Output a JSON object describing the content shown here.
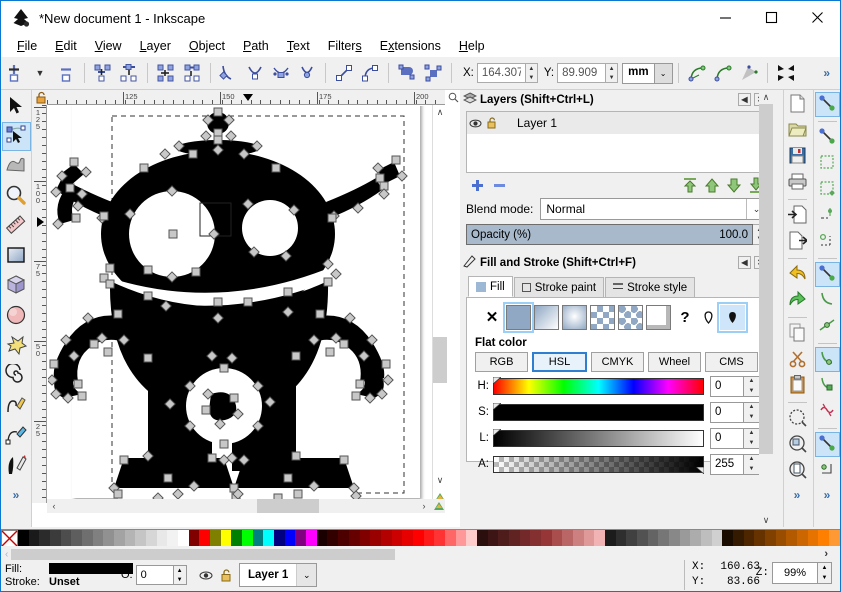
{
  "window": {
    "title": "*New document 1 - Inkscape",
    "app_icon": "inkscape-logo-icon",
    "controls": [
      {
        "name": "minimize-button",
        "glyph": "minimize-icon"
      },
      {
        "name": "maximize-button",
        "glyph": "maximize-icon"
      },
      {
        "name": "close-button",
        "glyph": "close-icon"
      }
    ]
  },
  "menubar": {
    "items": [
      {
        "label": "File",
        "mnemonic": "F"
      },
      {
        "label": "Edit",
        "mnemonic": "E"
      },
      {
        "label": "View",
        "mnemonic": "V"
      },
      {
        "label": "Layer",
        "mnemonic": "L"
      },
      {
        "label": "Object",
        "mnemonic": "O"
      },
      {
        "label": "Path",
        "mnemonic": "P"
      },
      {
        "label": "Text",
        "mnemonic": "T"
      },
      {
        "label": "Filters",
        "mnemonic": "s"
      },
      {
        "label": "Extensions",
        "mnemonic": "x"
      },
      {
        "label": "Help",
        "mnemonic": "H"
      }
    ]
  },
  "toolcontrols": {
    "x_label": "X:",
    "x_value": "164.307",
    "y_label": "Y:",
    "y_value": "89.909",
    "unit": "mm",
    "overflow_label": "»",
    "buttons": [
      "insert-node-icon",
      "insert-node-dropdown-icon",
      "delete-node-icon",
      "break-path-icon",
      "join-nodes-icon",
      "join-segment-icon",
      "delete-segment-icon",
      "node-cusp-icon",
      "node-smooth-icon",
      "node-symmetric-icon",
      "node-auto-icon",
      "segment-line-icon",
      "segment-curve-icon",
      "object-to-path-icon",
      "stroke-to-path-icon",
      "show-transform-handles-icon",
      "show-path-outline-icon",
      "show-clip-paths-icon",
      "show-mask-paths-icon"
    ]
  },
  "toolbox": {
    "tools": [
      {
        "name": "selector-tool",
        "icon": "arrow-cursor-icon",
        "active": false
      },
      {
        "name": "node-tool",
        "icon": "node-editor-icon",
        "active": true
      },
      {
        "name": "tweak-tool",
        "icon": "tweak-icon",
        "active": false
      },
      {
        "name": "zoom-tool",
        "icon": "magnifier-icon",
        "active": false
      },
      {
        "name": "measure-tool",
        "icon": "ruler-icon",
        "active": false
      },
      {
        "name": "rectangle-tool",
        "icon": "rectangle-icon",
        "active": false
      },
      {
        "name": "box3d-tool",
        "icon": "cube-icon",
        "active": false
      },
      {
        "name": "ellipse-tool",
        "icon": "circle-icon",
        "active": false
      },
      {
        "name": "star-tool",
        "icon": "star-icon",
        "active": false
      },
      {
        "name": "spiral-tool",
        "icon": "spiral-icon",
        "active": false
      },
      {
        "name": "pencil-tool",
        "icon": "pencil-icon",
        "active": false
      },
      {
        "name": "pen-tool",
        "icon": "pen-bezier-icon",
        "active": false
      },
      {
        "name": "calligraphy-tool",
        "icon": "calligraphy-pen-icon",
        "active": false
      }
    ],
    "overflow_label": "»"
  },
  "canvas": {
    "ruler_h_ticks": [
      "125",
      "150",
      "175",
      "200"
    ],
    "ruler_v_ticks": [
      "125",
      "100",
      "75",
      "50",
      "25"
    ],
    "artwork_name": "robot-silhouette-path",
    "zoom_corner_icon": "zoom-icon"
  },
  "layers_panel": {
    "title": "Layers (Shift+Ctrl+L)",
    "title_icon": "layers-icon",
    "collapse_icon": "collapse-icon",
    "close_icon": "close-icon",
    "rows": [
      {
        "name": "Layer 1",
        "visible_icon": "eye-icon",
        "lock_icon": "unlock-icon"
      }
    ],
    "buttons": [
      {
        "name": "add-layer-button",
        "icon": "plus-icon"
      },
      {
        "name": "remove-layer-button",
        "icon": "minus-icon"
      },
      {
        "name": "raise-to-top-button",
        "icon": "raise-top-icon"
      },
      {
        "name": "raise-layer-button",
        "icon": "raise-icon"
      },
      {
        "name": "lower-layer-button",
        "icon": "lower-icon"
      },
      {
        "name": "lower-to-bottom-button",
        "icon": "lower-bottom-icon"
      }
    ],
    "blend_mode_label": "Blend mode:",
    "blend_mode_value": "Normal",
    "opacity_label": "Opacity (%)",
    "opacity_value": "100.0"
  },
  "fill_stroke_panel": {
    "title": "Fill and Stroke (Shift+Ctrl+F)",
    "title_icon": "fill-stroke-icon",
    "collapse_icon": "collapse-icon",
    "close_icon": "close-icon",
    "tabs": [
      {
        "label": "Fill",
        "icon": "fill-swatch-icon",
        "active": true
      },
      {
        "label": "Stroke paint",
        "icon": "stroke-paint-icon",
        "active": false
      },
      {
        "label": "Stroke style",
        "icon": "stroke-style-icon",
        "active": false
      }
    ],
    "paint_types": [
      {
        "name": "no-paint-button",
        "icon": "x-icon",
        "selected": false
      },
      {
        "name": "flat-color-button",
        "icon": "flat-color-icon",
        "selected": true
      },
      {
        "name": "linear-gradient-button",
        "icon": "linear-gradient-icon",
        "selected": false
      },
      {
        "name": "radial-gradient-button",
        "icon": "radial-gradient-icon",
        "selected": false
      },
      {
        "name": "pattern-button",
        "icon": "pattern-icon",
        "selected": false
      },
      {
        "name": "swatch-button",
        "icon": "swatch-icon",
        "selected": false
      },
      {
        "name": "unknown-paint-button",
        "icon": "unknown-paint-icon",
        "selected": false
      },
      {
        "name": "unknown-question-button",
        "icon": "question-mark-icon",
        "selected": false
      },
      {
        "name": "fill-rule-evenodd-button",
        "icon": "fill-rule-evenodd-icon",
        "selected": false
      },
      {
        "name": "fill-rule-nonzero-button",
        "icon": "fill-rule-nonzero-icon",
        "selected": true
      }
    ],
    "flat_color_label": "Flat color",
    "color_modes": [
      {
        "label": "RGB",
        "selected": false
      },
      {
        "label": "HSL",
        "selected": true
      },
      {
        "label": "CMYK",
        "selected": false
      },
      {
        "label": "Wheel",
        "selected": false
      },
      {
        "label": "CMS",
        "selected": false
      }
    ],
    "channels": [
      {
        "label": "H:",
        "value": "0",
        "slider": "hue-slider"
      },
      {
        "label": "S:",
        "value": "0",
        "slider": "saturation-slider"
      },
      {
        "label": "L:",
        "value": "0",
        "slider": "lightness-slider"
      },
      {
        "label": "A:",
        "value": "255",
        "slider": "alpha-slider"
      }
    ]
  },
  "command_bar": {
    "buttons": [
      {
        "name": "new-document-button",
        "icon": "new-document-icon"
      },
      {
        "name": "open-document-button",
        "icon": "open-folder-icon"
      },
      {
        "name": "save-document-button",
        "icon": "save-disk-icon"
      },
      {
        "name": "print-button",
        "icon": "printer-icon"
      },
      {
        "name": "import-button",
        "icon": "import-icon"
      },
      {
        "name": "export-button",
        "icon": "export-icon"
      },
      {
        "name": "undo-button",
        "icon": "undo-arrow-icon"
      },
      {
        "name": "redo-button",
        "icon": "redo-arrow-icon"
      },
      {
        "name": "copy-button",
        "icon": "copy-icon"
      },
      {
        "name": "cut-button",
        "icon": "scissors-icon"
      },
      {
        "name": "paste-button",
        "icon": "clipboard-icon"
      },
      {
        "name": "zoom-selection-button",
        "icon": "zoom-selection-icon"
      },
      {
        "name": "zoom-drawing-button",
        "icon": "zoom-drawing-icon"
      },
      {
        "name": "zoom-page-button",
        "icon": "zoom-page-icon"
      }
    ],
    "overflow_label": "»"
  },
  "snap_bar": {
    "buttons": [
      {
        "name": "enable-snapping-button",
        "icon": "snap-icon",
        "selected": true
      },
      {
        "name": "snap-bounding-box-button",
        "icon": "snap-bbox-icon",
        "selected": false
      },
      {
        "name": "snap-bbox-edge-button",
        "icon": "snap-bbox-edge-icon",
        "selected": false
      },
      {
        "name": "snap-bbox-corner-button",
        "icon": "snap-bbox-corner-icon",
        "selected": false
      },
      {
        "name": "snap-bbox-edge-midpoint-button",
        "icon": "snap-edge-midpoint-icon",
        "selected": false
      },
      {
        "name": "snap-bbox-center-button",
        "icon": "snap-center-icon",
        "selected": false
      },
      {
        "name": "snap-nodes-button",
        "icon": "snap-nodes-icon",
        "selected": true
      },
      {
        "name": "snap-paths-button",
        "icon": "snap-path-icon",
        "selected": false
      },
      {
        "name": "snap-path-intersection-button",
        "icon": "snap-intersection-icon",
        "selected": false
      },
      {
        "name": "snap-cusp-nodes-button",
        "icon": "snap-cusp-icon",
        "selected": true
      },
      {
        "name": "snap-smooth-nodes-button",
        "icon": "snap-smooth-icon",
        "selected": false
      },
      {
        "name": "snap-midpoints-button",
        "icon": "snap-midpoint-icon",
        "selected": false
      },
      {
        "name": "snap-others-button",
        "icon": "snap-others-icon",
        "selected": true
      },
      {
        "name": "snap-page-border-button",
        "icon": "snap-page-border-icon",
        "selected": false
      }
    ],
    "overflow_label": "»"
  },
  "palette": {
    "none_swatch": "no-color-icon",
    "colors": [
      "#000000",
      "#1a1a1a",
      "#2b2b2b",
      "#3b3b3b",
      "#4d4d4d",
      "#5e5e5e",
      "#6f6f6f",
      "#808080",
      "#919191",
      "#a3a3a3",
      "#b4b4b4",
      "#c5c5c5",
      "#d6d6d6",
      "#e8e8e8",
      "#f2f2f2",
      "#ffffff",
      "#800000",
      "#ff0000",
      "#808000",
      "#ffff00",
      "#008000",
      "#00ff00",
      "#008080",
      "#00ffff",
      "#000080",
      "#0000ff",
      "#800080",
      "#ff00ff",
      "#1a0000",
      "#330000",
      "#4d0000",
      "#660000",
      "#800000",
      "#990000",
      "#b30000",
      "#cc0000",
      "#e60000",
      "#ff0000",
      "#ff1a1a",
      "#ff3333",
      "#ff6666",
      "#ff9999",
      "#ffcccc",
      "#2b0f0f",
      "#3d1515",
      "#4f1c1c",
      "#612222",
      "#732929",
      "#853030",
      "#973636",
      "#a94d4d",
      "#bb6666",
      "#cd8080",
      "#df9999",
      "#f1b3b3",
      "#1c1c1c",
      "#2e2e2e",
      "#404040",
      "#525252",
      "#646464",
      "#767676",
      "#888888",
      "#9a9a9a",
      "#acacac",
      "#bebebe",
      "#d0d0d0",
      "#1a0d00",
      "#331a00",
      "#4d2600",
      "#663300",
      "#804000",
      "#994d00",
      "#b35900",
      "#cc6600",
      "#e67300",
      "#ff8000",
      "#ff9933"
    ]
  },
  "statusbar": {
    "fill_label": "Fill:",
    "fill_value_color": "#000000",
    "stroke_label": "Stroke:",
    "stroke_value": "Unset",
    "opacity_label": "O:",
    "opacity_value": "0",
    "layer_name": "Layer 1",
    "layer_visible_icon": "eye-icon",
    "layer_lock_icon": "unlock-icon",
    "pointer_x_label": "X:",
    "pointer_x_value": "160.63",
    "pointer_y_label": "Y:",
    "pointer_y_value": "83.66",
    "zoom_label": "Z:",
    "zoom_value": "99%",
    "overflow_label": "›"
  }
}
